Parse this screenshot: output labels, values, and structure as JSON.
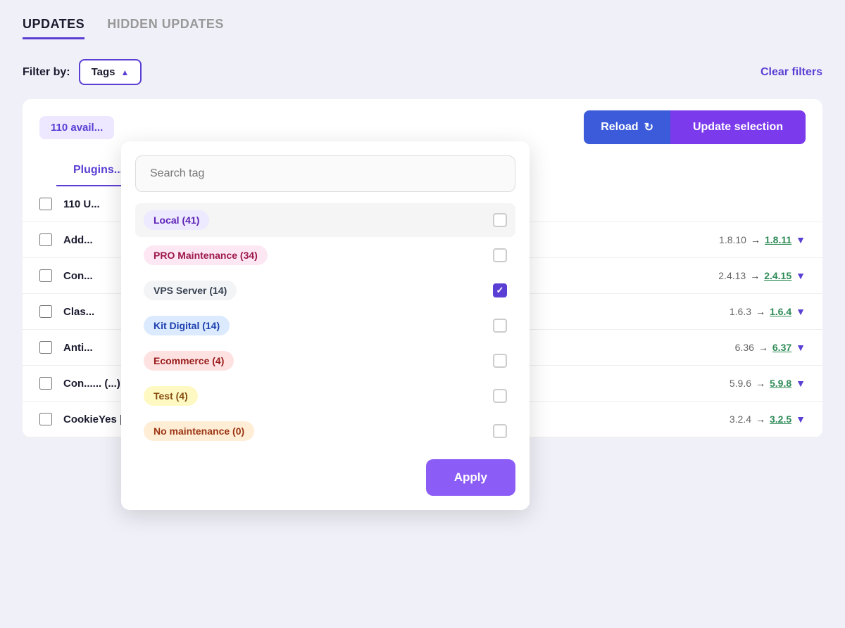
{
  "tabs": [
    {
      "id": "updates",
      "label": "UPDATES",
      "active": true
    },
    {
      "id": "hidden-updates",
      "label": "HIDDEN UPDATES",
      "active": false
    }
  ],
  "filter": {
    "label": "Filter by:",
    "tags_button": "Tags",
    "clear_filters": "Clear filters"
  },
  "avail_bar": {
    "count_label": "110 avail...",
    "reload_label": "Reload",
    "update_selection_label": "Update selection"
  },
  "plugins_header": {
    "label": "Plugins..."
  },
  "dropdown": {
    "search_placeholder": "Search tag",
    "apply_label": "Apply",
    "tags": [
      {
        "id": "local",
        "label": "Local (41)",
        "color": "#d8b4fe",
        "bg": "#ede9fe",
        "checked": false,
        "hovered": true
      },
      {
        "id": "pro-maintenance",
        "label": "PRO Maintenance (34)",
        "color": "#f472b6",
        "bg": "#fce7f3",
        "checked": false,
        "hovered": false
      },
      {
        "id": "vps-server",
        "label": "VPS Server (14)",
        "color": "#9ca3af",
        "bg": "#f3f4f6",
        "checked": true,
        "hovered": false
      },
      {
        "id": "kit-digital",
        "label": "Kit Digital (14)",
        "color": "#60a5fa",
        "bg": "#dbeafe",
        "checked": false,
        "hovered": false
      },
      {
        "id": "ecommerce",
        "label": "Ecommerce (4)",
        "color": "#f87171",
        "bg": "#fee2e2",
        "checked": false,
        "hovered": false
      },
      {
        "id": "test",
        "label": "Test (4)",
        "color": "#fcd34d",
        "bg": "#fef9c3",
        "checked": false,
        "hovered": false
      },
      {
        "id": "no-maintenance",
        "label": "No maintenance (0)",
        "color": "#fdba74",
        "bg": "#ffedd5",
        "checked": false,
        "hovered": false
      }
    ]
  },
  "table_rows": [
    {
      "id": "row1",
      "name": "110 U...",
      "v_from": "—",
      "v_to": "—",
      "show_version": false
    },
    {
      "id": "row2",
      "name": "Add...",
      "v_from": "1.8.10",
      "arrow": "→",
      "v_to": "1.8.11",
      "show_version": true
    },
    {
      "id": "row3",
      "name": "Con...",
      "v_from": "2.4.13",
      "arrow": "→",
      "v_to": "2.4.15",
      "show_version": true
    },
    {
      "id": "row4",
      "name": "Clas...",
      "v_from": "1.6.3",
      "arrow": "→",
      "v_to": "1.6.4",
      "show_version": true
    },
    {
      "id": "row5",
      "name": "Anti...",
      "v_from": "6.36",
      "arrow": "→",
      "v_to": "6.37",
      "show_version": true
    },
    {
      "id": "row6",
      "name": "Con......  (...)",
      "v_from": "5.9.6",
      "arrow": "→",
      "v_to": "5.9.8",
      "show_version": true
    },
    {
      "id": "row7",
      "name": "CookieYes | GDPR Cookie Consent (1)",
      "v_from": "3.2.4",
      "arrow": "→",
      "v_to": "3.2.5",
      "show_version": true
    }
  ]
}
